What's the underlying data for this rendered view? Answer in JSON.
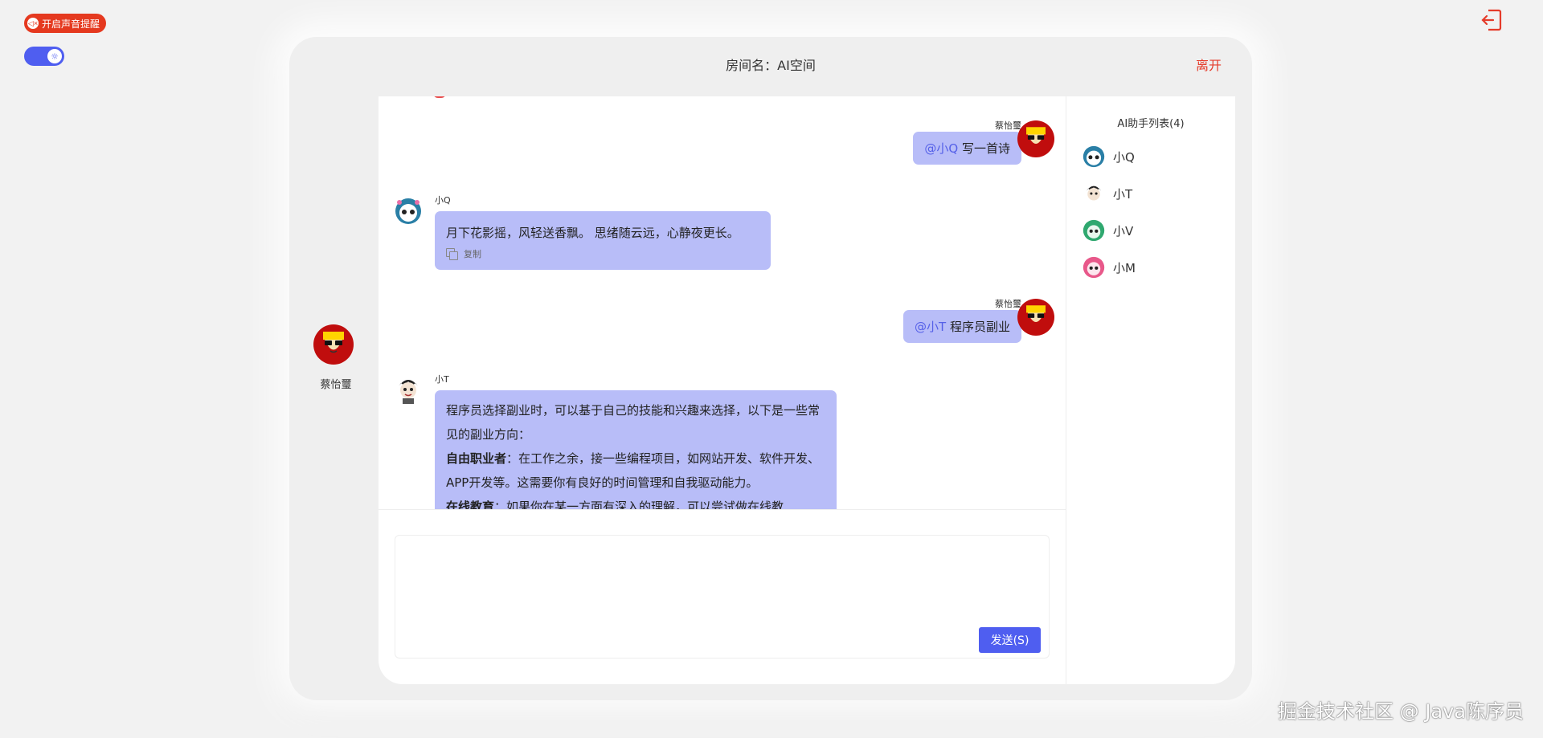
{
  "controls": {
    "sound_label": "开启声音提醒"
  },
  "room": {
    "title": "房间名：AI空间",
    "leave_label": "离开"
  },
  "current_user": {
    "name": "蔡怡璽"
  },
  "messages": [
    {
      "sender": "蔡怡璽",
      "mention": "@小Q",
      "text": " 写一首诗"
    },
    {
      "sender": "小Q",
      "text": "月下花影摇，风轻送香飘。 思绪随云远，心静夜更长。",
      "copy_label": "复制"
    },
    {
      "sender": "蔡怡璽",
      "mention": "@小T",
      "text": " 程序员副业"
    },
    {
      "sender": "小T",
      "line1": "程序员选择副业时，可以基于自己的技能和兴趣来选择，以下是一些常见的副业方向：",
      "bold1": "自由职业者",
      "line2": "：在工作之余，接一些编程项目，如网站开发、软件开发、APP开发等。这需要你有良好的时间管理和自我驱动能力。",
      "bold2": "在线教育",
      "line3": "：如果你在某一方面有深入的理解，可以尝试做在线教"
    }
  ],
  "composer": {
    "send_label": "发送(S)"
  },
  "ai_list": {
    "title": "AI助手列表(4)",
    "items": [
      {
        "name": "小Q"
      },
      {
        "name": "小T"
      },
      {
        "name": "小V"
      },
      {
        "name": "小M"
      }
    ]
  },
  "watermark": "掘金技术社区 @ Java陈序员",
  "colors": {
    "accent": "#4f5ef0",
    "bubble": "#b8bdf8",
    "danger": "#e53b2a"
  }
}
